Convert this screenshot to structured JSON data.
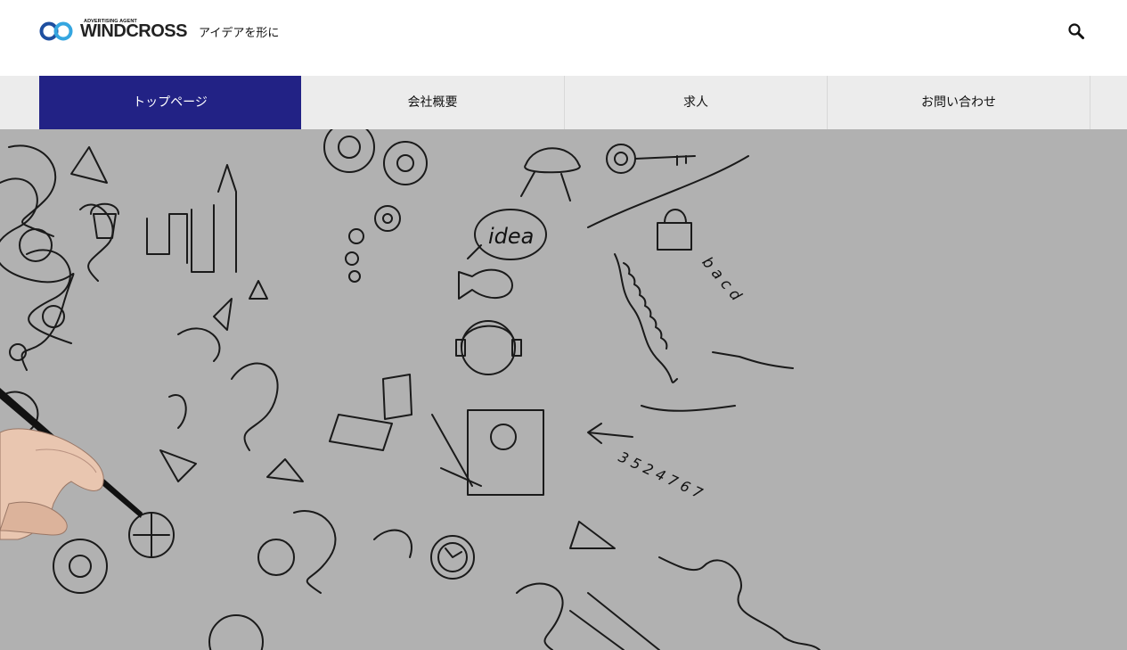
{
  "header": {
    "logo_small_text": "ADVERTISING AGENT",
    "logo_main_text": "WINDCROSS",
    "tagline": "アイデアを形に",
    "search_icon": "search-icon"
  },
  "nav": {
    "items": [
      {
        "label": "トップページ",
        "active": true
      },
      {
        "label": "会社概要",
        "active": false
      },
      {
        "label": "求人",
        "active": false
      },
      {
        "label": "お問い合わせ",
        "active": false
      }
    ]
  },
  "hero": {
    "doodle_idea_text": "idea",
    "doodle_letters": "b a c d",
    "doodle_numbers": "3 5 2 4 7 6 7"
  },
  "colors": {
    "nav_active": "#222285",
    "nav_bg": "#ececec",
    "hero_bg": "#b1b1b1",
    "logo_blue": "#2a6fc2",
    "logo_light_blue": "#35a6e0"
  }
}
